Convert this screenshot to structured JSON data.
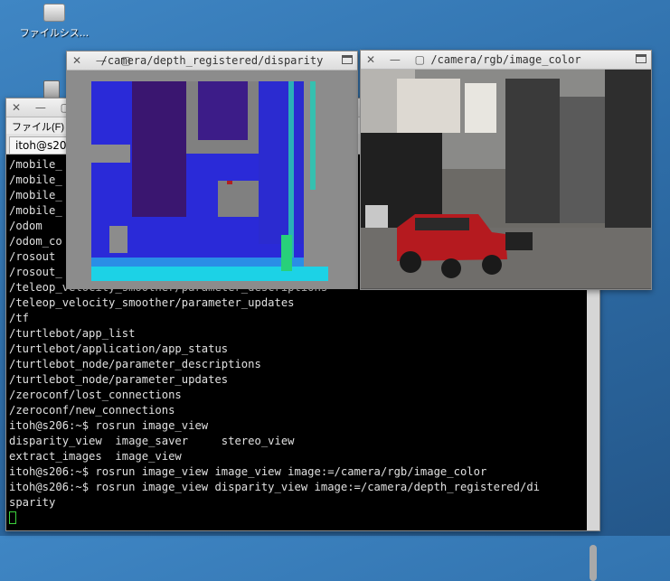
{
  "desktop": {
    "filesystem_icon_label": "ファイルシス..."
  },
  "terminal": {
    "menu_file": "ファイル(F)",
    "tab_label": "itoh@s20",
    "lines": [
      "/mobile_",
      "/mobile_",
      "/mobile_",
      "/mobile_",
      "/odom",
      "/odom_co",
      "/rosout",
      "/rosout_",
      "/teleop_velocity_smoother/parameter_descriptions",
      "/teleop_velocity_smoother/parameter_updates",
      "/tf",
      "/turtlebot/app_list",
      "/turtlebot/application/app_status",
      "/turtlebot_node/parameter_descriptions",
      "/turtlebot_node/parameter_updates",
      "/zeroconf/lost_connections",
      "/zeroconf/new_connections",
      "itoh@s206:~$ rosrun image_view",
      "disparity_view  image_saver     stereo_view",
      "extract_images  image_view",
      "itoh@s206:~$ rosrun image_view image_view image:=/camera/rgb/image_color",
      "itoh@s206:~$ rosrun image_view disparity_view image:=/camera/depth_registered/di",
      "sparity"
    ]
  },
  "disparity_window": {
    "title": "/camera/depth_registered/disparity",
    "buttons": "✕ — ▢"
  },
  "rgb_window": {
    "title": "/camera/rgb/image_color",
    "buttons": "✕ — ▢"
  },
  "colors": {
    "terminal_bg": "#000000",
    "terminal_fg": "#e0e0e0",
    "cursor": "#3cd13c",
    "desktop_bg": "#3576b4"
  }
}
